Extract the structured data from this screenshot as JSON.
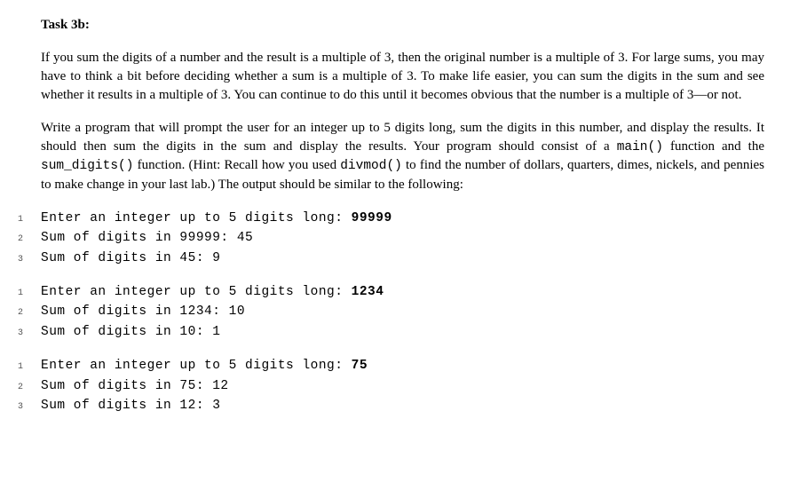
{
  "heading": "Task 3b:",
  "para1": "If you sum the digits of a number and the result is a multiple of 3, then the original number is a multiple of 3. For large sums, you may have to think a bit before deciding whether a sum is a multiple of 3. To make life easier, you can sum the digits in the sum and see whether it results in a multiple of 3. You can continue to do this until it becomes obvious that the number is a multiple of 3—or not.",
  "para2_part1": "Write a program that will prompt the user for an integer up to 5 digits long, sum the digits in this number, and display the results. It should then sum the digits in the sum and display the results. Your program should consist of a ",
  "para2_main": "main()",
  "para2_part2": " function and the ",
  "para2_sumdigits": "sum_digits()",
  "para2_part3": " function. (Hint: Recall how you used ",
  "para2_divmod": "divmod()",
  "para2_part4": " to find the number of dollars, quarters, dimes, nickels, and pennies to make change in your last lab.) The output should be similar to the following:",
  "examples": [
    {
      "lines": [
        {
          "n": "1",
          "prefix": "Enter an integer up to 5 digits long: ",
          "bold": "99999"
        },
        {
          "n": "2",
          "prefix": "Sum of digits in 99999: 45",
          "bold": ""
        },
        {
          "n": "3",
          "prefix": "Sum of digits in 45: 9",
          "bold": ""
        }
      ]
    },
    {
      "lines": [
        {
          "n": "1",
          "prefix": "Enter an integer up to 5 digits long: ",
          "bold": "1234"
        },
        {
          "n": "2",
          "prefix": "Sum of digits in 1234: 10",
          "bold": ""
        },
        {
          "n": "3",
          "prefix": "Sum of digits in 10: 1",
          "bold": ""
        }
      ]
    },
    {
      "lines": [
        {
          "n": "1",
          "prefix": "Enter an integer up to 5 digits long: ",
          "bold": "75"
        },
        {
          "n": "2",
          "prefix": "Sum of digits in 75: 12",
          "bold": ""
        },
        {
          "n": "3",
          "prefix": "Sum of digits in 12: 3",
          "bold": ""
        }
      ]
    }
  ]
}
